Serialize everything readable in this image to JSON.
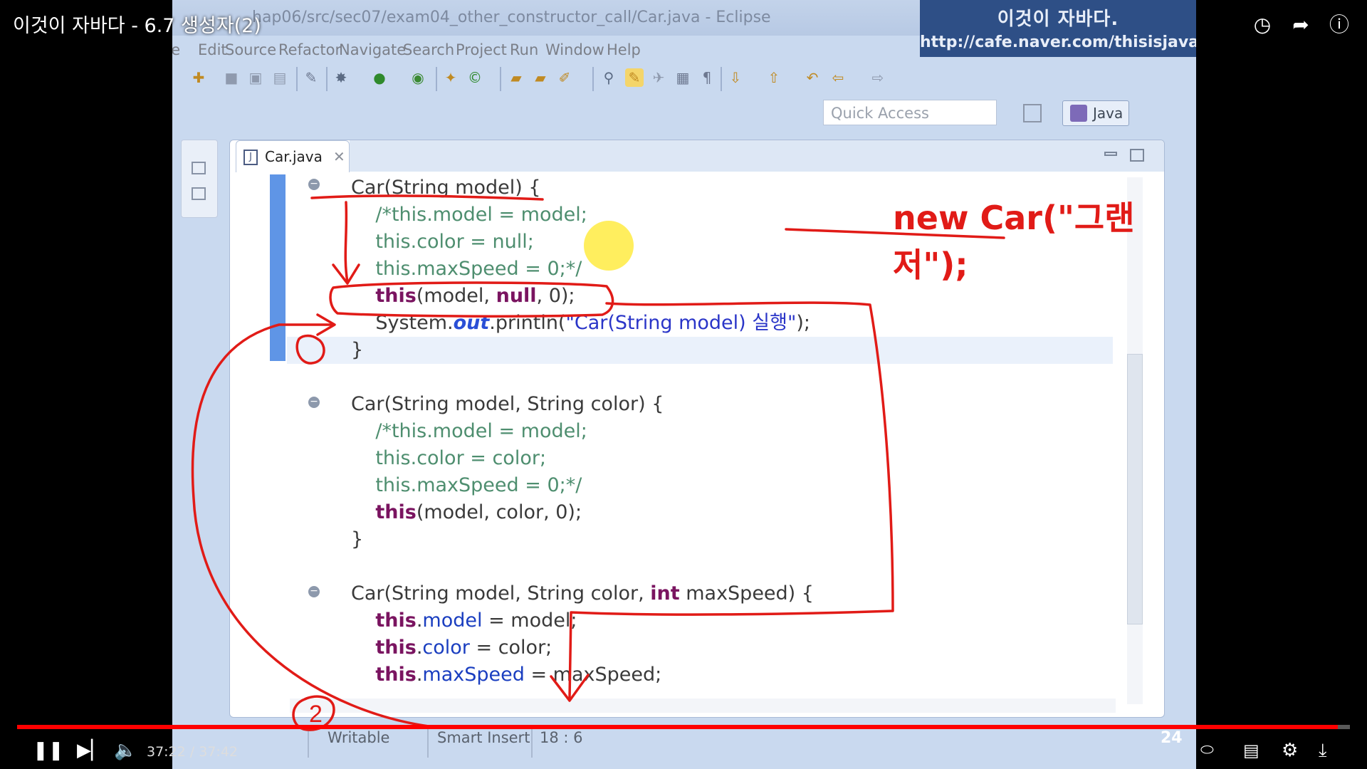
{
  "youtube": {
    "title": "이것이 자바다 - 6.7 생성자(2)",
    "time": "37:22 / 37:42",
    "progress": 0.991,
    "icons": [
      "clock-icon",
      "share-icon",
      "info-icon",
      "pause-icon",
      "next-icon",
      "volume-icon",
      "autoplay-toggle",
      "subtitles-icon",
      "settings-icon",
      "exit-fullscreen-icon"
    ]
  },
  "eclipse": {
    "window_title": "hap06/src/sec07/exam04_other_constructor_call/Car.java - Eclipse",
    "watermark_line1": "이것이 자바다.",
    "watermark_line2": "http://cafe.naver.com/thisisjava",
    "menus": [
      "File",
      "Edit",
      "Source",
      "Refactor",
      "Navigate",
      "Search",
      "Project",
      "Run",
      "Window",
      "Help"
    ],
    "quick_access_placeholder": "Quick Access",
    "perspective": "Java",
    "tab_label": "Car.java",
    "status": {
      "writable": "Writable",
      "insert_mode": "Smart Insert",
      "position": "18 : 6"
    },
    "badge": "24"
  },
  "annotation": {
    "text": "new Car(\"그랜저\");",
    "circle_label": "2"
  },
  "colors": {
    "annotation_red": "#e11b17",
    "progress_red": "#ff0000",
    "keyword": "#7a1460",
    "comment": "#4e8e6f",
    "field": "#1a3ec0"
  }
}
